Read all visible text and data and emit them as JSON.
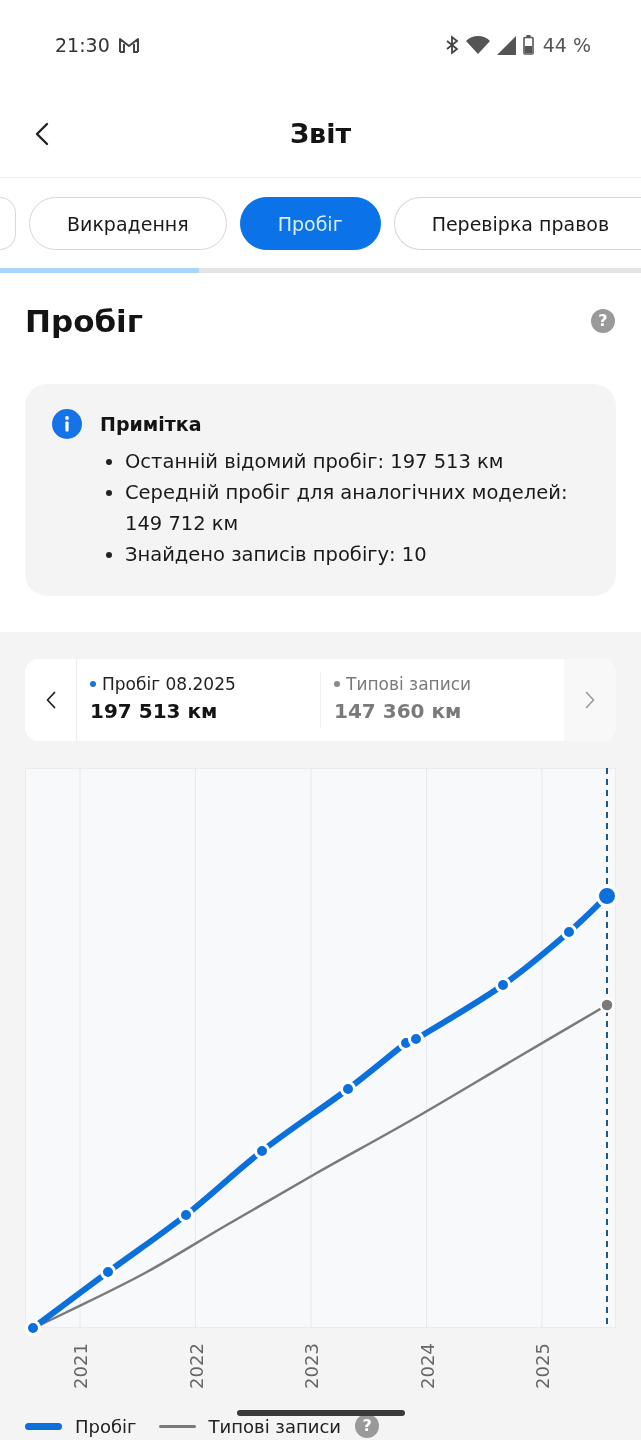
{
  "status_bar": {
    "time": "21:30",
    "battery": "44 %"
  },
  "header": {
    "title": "Звіт"
  },
  "tab_strip": {
    "clipped_left": true,
    "tabs": [
      {
        "label": "Викрадення",
        "selected": false,
        "clipped": false
      },
      {
        "label": "Пробіг",
        "selected": true,
        "clipped": false
      },
      {
        "label": "Перевірка правов",
        "selected": false,
        "clipped": true
      }
    ],
    "progress": {
      "level": 0.31
    }
  },
  "section": {
    "title": "Пробіг",
    "help": "?"
  },
  "note": {
    "title": "Примітка",
    "items": [
      "Останній відомий пробіг: 197 513 км",
      "Середній пробіг для аналогічних моделей: 149 712 км",
      "Знайдено записів пробігу: 10"
    ]
  },
  "chart": {
    "summary": {
      "prev_disabled": false,
      "next_disabled": true,
      "entries": [
        {
          "label": "Пробіг 08.2025",
          "value": "197 513 км",
          "color": "#1a73d9",
          "muted": false
        },
        {
          "label": "Типові записи",
          "value": "147 360 км",
          "color": "#8a8a8a",
          "muted": true
        }
      ]
    },
    "x_labels": [
      "2021",
      "2022",
      "2023",
      "2024",
      "2025"
    ],
    "legend": [
      {
        "label": "Пробіг",
        "color": "#0b6fdc",
        "kind": "thick"
      },
      {
        "label": "Типові записи",
        "color": "#7a7a7a",
        "kind": "thin"
      }
    ],
    "legend_help": "?"
  }
}
